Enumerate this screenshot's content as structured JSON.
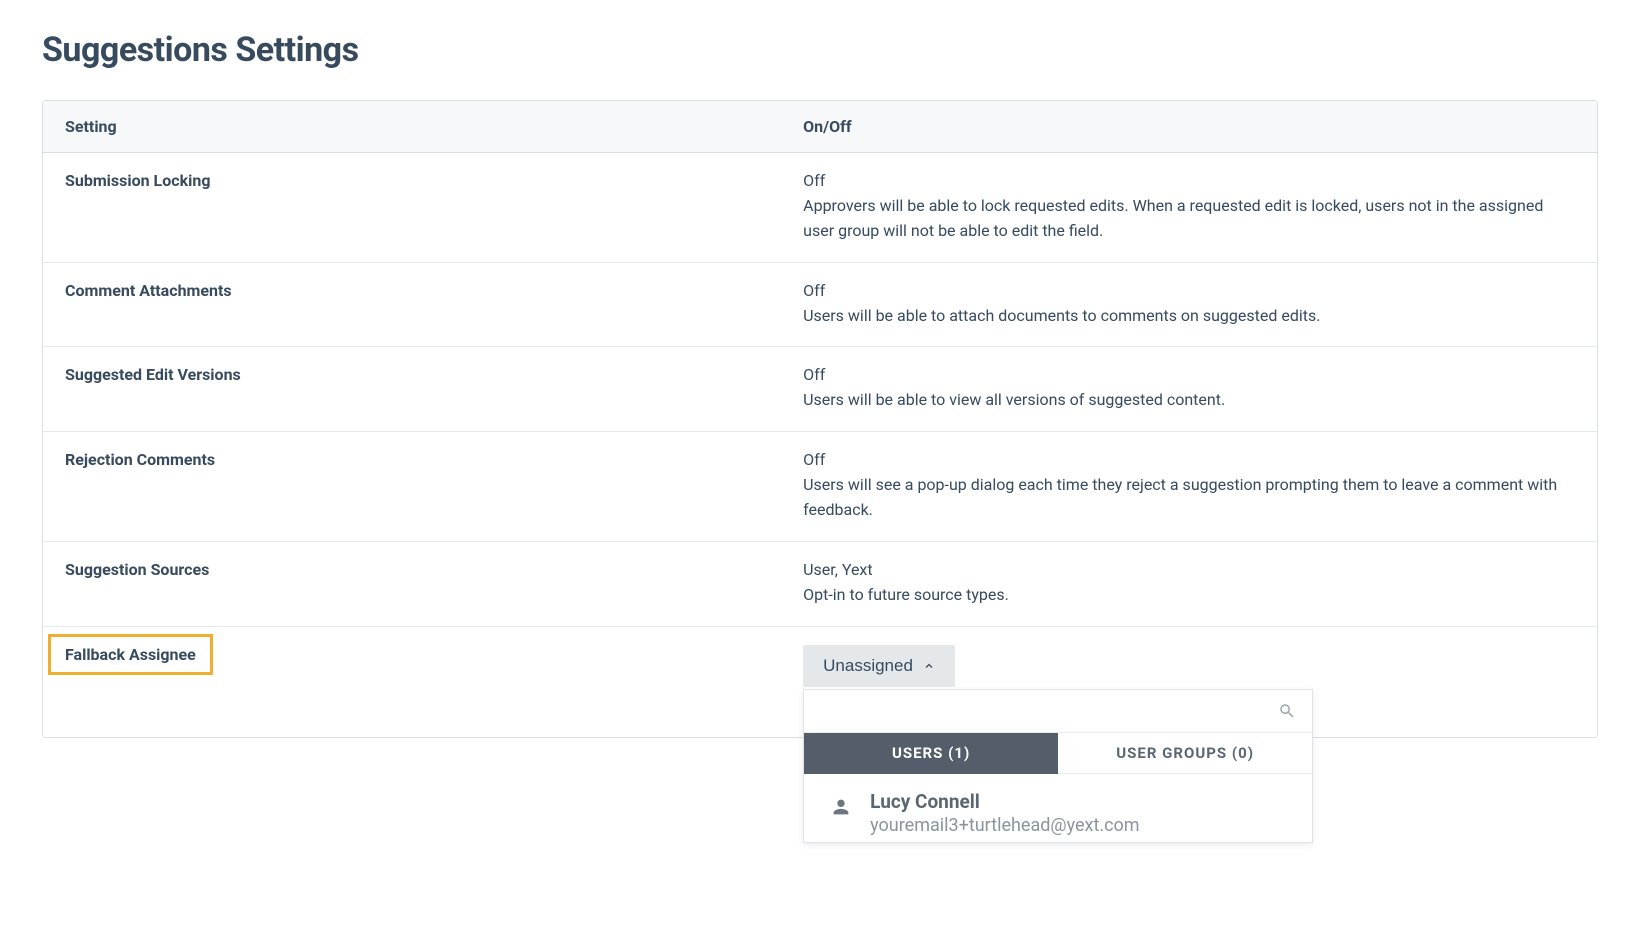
{
  "page": {
    "title": "Suggestions Settings"
  },
  "table": {
    "header": {
      "setting": "Setting",
      "onoff": "On/Off"
    },
    "rows": {
      "submission_locking": {
        "name": "Submission Locking",
        "status": "Off",
        "description": "Approvers will be able to lock requested edits. When a requested edit is locked, users not in the assigned user group will not be able to edit the field."
      },
      "comment_attachments": {
        "name": "Comment Attachments",
        "status": "Off",
        "description": "Users will be able to attach documents to comments on suggested edits."
      },
      "suggested_edit_versions": {
        "name": "Suggested Edit Versions",
        "status": "Off",
        "description": "Users will be able to view all versions of suggested content."
      },
      "rejection_comments": {
        "name": "Rejection Comments",
        "status": "Off",
        "description": "Users will see a pop-up dialog each time they reject a suggestion prompting them to leave a comment with feedback."
      },
      "suggestion_sources": {
        "name": "Suggestion Sources",
        "status": "User, Yext",
        "description": "Opt-in to future source types."
      },
      "fallback_assignee": {
        "name": "Fallback Assignee"
      }
    }
  },
  "dropdown": {
    "button_label": "Unassigned",
    "search_placeholder": "",
    "tabs": {
      "users": "USERS (1)",
      "user_groups": "USER GROUPS (0)"
    },
    "results": {
      "user1": {
        "name": "Lucy Connell",
        "email": "youremail3+turtlehead@yext.com"
      }
    }
  }
}
